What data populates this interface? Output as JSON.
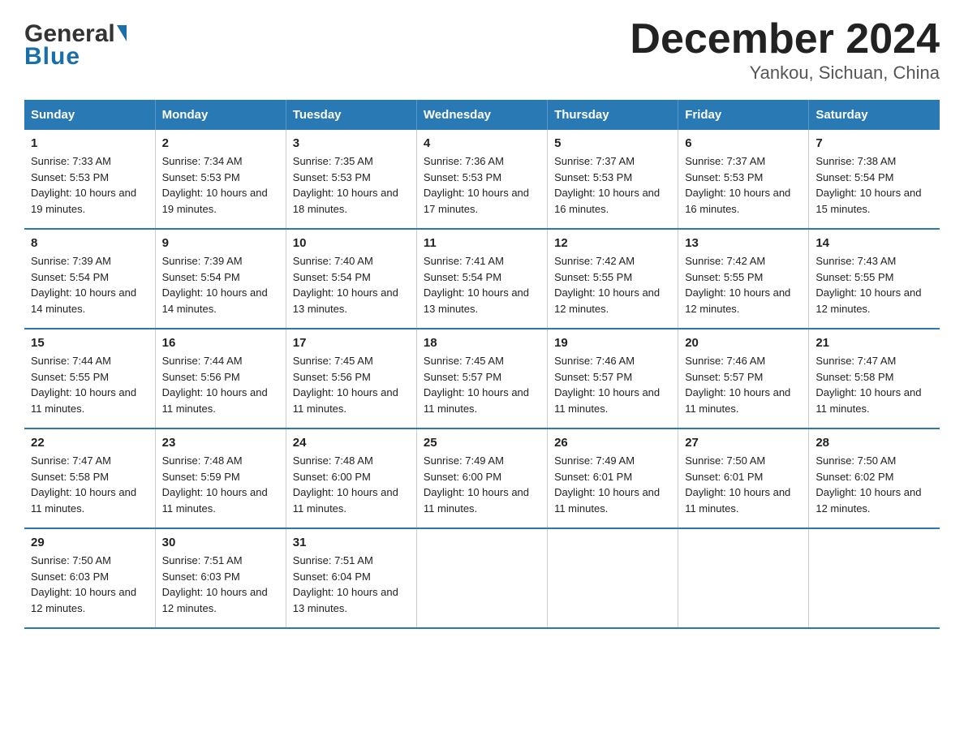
{
  "header": {
    "logo_general": "General",
    "logo_blue": "Blue",
    "title": "December 2024",
    "subtitle": "Yankou, Sichuan, China"
  },
  "days_of_week": [
    "Sunday",
    "Monday",
    "Tuesday",
    "Wednesday",
    "Thursday",
    "Friday",
    "Saturday"
  ],
  "weeks": [
    [
      {
        "num": "1",
        "sunrise": "7:33 AM",
        "sunset": "5:53 PM",
        "daylight": "10 hours and 19 minutes."
      },
      {
        "num": "2",
        "sunrise": "7:34 AM",
        "sunset": "5:53 PM",
        "daylight": "10 hours and 19 minutes."
      },
      {
        "num": "3",
        "sunrise": "7:35 AM",
        "sunset": "5:53 PM",
        "daylight": "10 hours and 18 minutes."
      },
      {
        "num": "4",
        "sunrise": "7:36 AM",
        "sunset": "5:53 PM",
        "daylight": "10 hours and 17 minutes."
      },
      {
        "num": "5",
        "sunrise": "7:37 AM",
        "sunset": "5:53 PM",
        "daylight": "10 hours and 16 minutes."
      },
      {
        "num": "6",
        "sunrise": "7:37 AM",
        "sunset": "5:53 PM",
        "daylight": "10 hours and 16 minutes."
      },
      {
        "num": "7",
        "sunrise": "7:38 AM",
        "sunset": "5:54 PM",
        "daylight": "10 hours and 15 minutes."
      }
    ],
    [
      {
        "num": "8",
        "sunrise": "7:39 AM",
        "sunset": "5:54 PM",
        "daylight": "10 hours and 14 minutes."
      },
      {
        "num": "9",
        "sunrise": "7:39 AM",
        "sunset": "5:54 PM",
        "daylight": "10 hours and 14 minutes."
      },
      {
        "num": "10",
        "sunrise": "7:40 AM",
        "sunset": "5:54 PM",
        "daylight": "10 hours and 13 minutes."
      },
      {
        "num": "11",
        "sunrise": "7:41 AM",
        "sunset": "5:54 PM",
        "daylight": "10 hours and 13 minutes."
      },
      {
        "num": "12",
        "sunrise": "7:42 AM",
        "sunset": "5:55 PM",
        "daylight": "10 hours and 12 minutes."
      },
      {
        "num": "13",
        "sunrise": "7:42 AM",
        "sunset": "5:55 PM",
        "daylight": "10 hours and 12 minutes."
      },
      {
        "num": "14",
        "sunrise": "7:43 AM",
        "sunset": "5:55 PM",
        "daylight": "10 hours and 12 minutes."
      }
    ],
    [
      {
        "num": "15",
        "sunrise": "7:44 AM",
        "sunset": "5:55 PM",
        "daylight": "10 hours and 11 minutes."
      },
      {
        "num": "16",
        "sunrise": "7:44 AM",
        "sunset": "5:56 PM",
        "daylight": "10 hours and 11 minutes."
      },
      {
        "num": "17",
        "sunrise": "7:45 AM",
        "sunset": "5:56 PM",
        "daylight": "10 hours and 11 minutes."
      },
      {
        "num": "18",
        "sunrise": "7:45 AM",
        "sunset": "5:57 PM",
        "daylight": "10 hours and 11 minutes."
      },
      {
        "num": "19",
        "sunrise": "7:46 AM",
        "sunset": "5:57 PM",
        "daylight": "10 hours and 11 minutes."
      },
      {
        "num": "20",
        "sunrise": "7:46 AM",
        "sunset": "5:57 PM",
        "daylight": "10 hours and 11 minutes."
      },
      {
        "num": "21",
        "sunrise": "7:47 AM",
        "sunset": "5:58 PM",
        "daylight": "10 hours and 11 minutes."
      }
    ],
    [
      {
        "num": "22",
        "sunrise": "7:47 AM",
        "sunset": "5:58 PM",
        "daylight": "10 hours and 11 minutes."
      },
      {
        "num": "23",
        "sunrise": "7:48 AM",
        "sunset": "5:59 PM",
        "daylight": "10 hours and 11 minutes."
      },
      {
        "num": "24",
        "sunrise": "7:48 AM",
        "sunset": "6:00 PM",
        "daylight": "10 hours and 11 minutes."
      },
      {
        "num": "25",
        "sunrise": "7:49 AM",
        "sunset": "6:00 PM",
        "daylight": "10 hours and 11 minutes."
      },
      {
        "num": "26",
        "sunrise": "7:49 AM",
        "sunset": "6:01 PM",
        "daylight": "10 hours and 11 minutes."
      },
      {
        "num": "27",
        "sunrise": "7:50 AM",
        "sunset": "6:01 PM",
        "daylight": "10 hours and 11 minutes."
      },
      {
        "num": "28",
        "sunrise": "7:50 AM",
        "sunset": "6:02 PM",
        "daylight": "10 hours and 12 minutes."
      }
    ],
    [
      {
        "num": "29",
        "sunrise": "7:50 AM",
        "sunset": "6:03 PM",
        "daylight": "10 hours and 12 minutes."
      },
      {
        "num": "30",
        "sunrise": "7:51 AM",
        "sunset": "6:03 PM",
        "daylight": "10 hours and 12 minutes."
      },
      {
        "num": "31",
        "sunrise": "7:51 AM",
        "sunset": "6:04 PM",
        "daylight": "10 hours and 13 minutes."
      },
      {
        "num": "",
        "sunrise": "",
        "sunset": "",
        "daylight": ""
      },
      {
        "num": "",
        "sunrise": "",
        "sunset": "",
        "daylight": ""
      },
      {
        "num": "",
        "sunrise": "",
        "sunset": "",
        "daylight": ""
      },
      {
        "num": "",
        "sunrise": "",
        "sunset": "",
        "daylight": ""
      }
    ]
  ]
}
